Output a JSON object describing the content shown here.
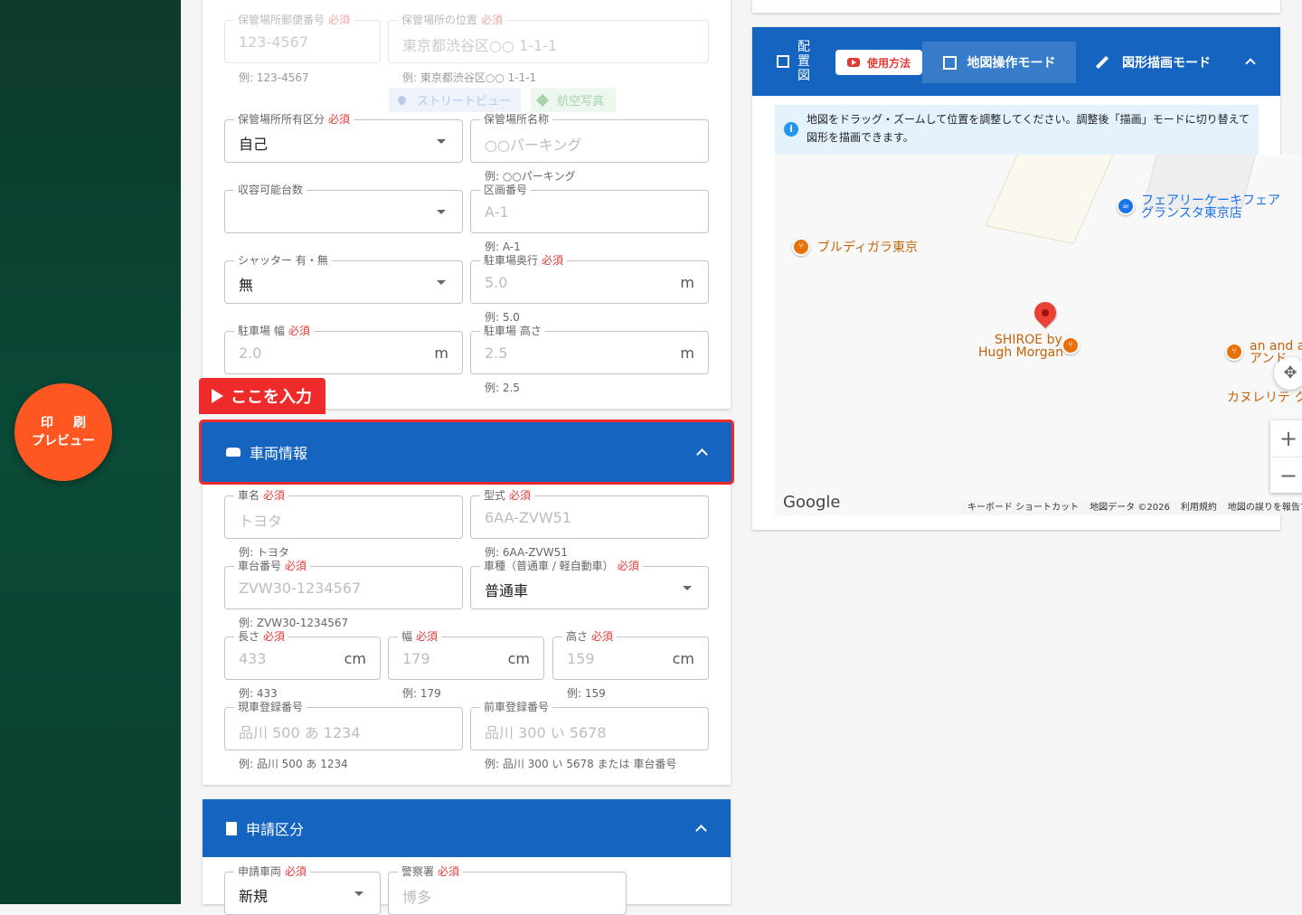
{
  "sidebar": {
    "print_line1": "印刷",
    "print_line2": "プレビュー"
  },
  "storage": {
    "postal": {
      "label": "保管場所郵便番号",
      "required": "必須",
      "placeholder": "123-4567",
      "help": "例: 123-4567"
    },
    "location": {
      "label": "保管場所の位置",
      "required": "必須",
      "placeholder": "東京都渋谷区○○ 1-1-1",
      "help": "例: 東京都渋谷区○○ 1-1-1"
    },
    "streetview": "ストリートビュー",
    "aerial": "航空写真",
    "ownership": {
      "label": "保管場所所有区分",
      "required": "必須",
      "value": "自己"
    },
    "name": {
      "label": "保管場所名称",
      "placeholder": "○○パーキング",
      "help": "例: ○○パーキング"
    },
    "capacity": {
      "label": "収容可能台数",
      "value": ""
    },
    "section_no": {
      "label": "区画番号",
      "placeholder": "A-1",
      "help": "例: A-1"
    },
    "shutter": {
      "label": "シャッター 有・無",
      "value": "無"
    },
    "depth": {
      "label": "駐車場奥行",
      "required": "必須",
      "placeholder": "5.0",
      "unit": "m",
      "help": "例: 5.0"
    },
    "width": {
      "label": "駐車場 幅",
      "required": "必須",
      "placeholder": "2.0",
      "unit": "m"
    },
    "height": {
      "label": "駐車場 高さ",
      "placeholder": "2.5",
      "unit": "m",
      "help": "例: 2.5"
    }
  },
  "callout": "ここを入力",
  "vehicle": {
    "title": "車両情報",
    "maker": {
      "label": "車名",
      "required": "必須",
      "placeholder": "トヨタ",
      "help": "例: トヨタ"
    },
    "model": {
      "label": "型式",
      "required": "必須",
      "placeholder": "6AA-ZVW51",
      "help": "例: 6AA-ZVW51"
    },
    "chassis": {
      "label": "車台番号",
      "required": "必須",
      "placeholder": "ZVW30-1234567",
      "help": "例: ZVW30-1234567"
    },
    "kind": {
      "label": "車種（普通車 / 軽自動車）",
      "required": "必須",
      "value": "普通車"
    },
    "length": {
      "label": "長さ",
      "required": "必須",
      "placeholder": "433",
      "unit": "cm",
      "help": "例: 433"
    },
    "width": {
      "label": "幅",
      "required": "必須",
      "placeholder": "179",
      "unit": "cm",
      "help": "例: 179"
    },
    "height": {
      "label": "高さ",
      "required": "必須",
      "placeholder": "159",
      "unit": "cm",
      "help": "例: 159"
    },
    "current_plate": {
      "label": "現車登録番号",
      "placeholder": "品川 500 あ 1234",
      "help": "例: 品川 500 あ 1234"
    },
    "previous_plate": {
      "label": "前車登録番号",
      "placeholder": "品川 300 い 5678",
      "help": "例: 品川 300 い 5678 または 車台番号"
    }
  },
  "application": {
    "title": "申請区分",
    "vehicle": {
      "label": "申請車両",
      "required": "必須",
      "value": "新規"
    },
    "police": {
      "label": "警察署",
      "required": "必須",
      "placeholder": "博多"
    }
  },
  "map_panel": {
    "title": "配置図",
    "howto": "使用方法",
    "mode_map": "地図操作モード",
    "mode_draw": "図形描画モード",
    "info": "地図をドラッグ・ズームして位置を調整してください。調整後「描画」モードに切り替えて図形を描画できます。",
    "info_icon": "i",
    "pois": [
      "ブルディガラ東京",
      "フェアリーケーキフェア",
      "グランスタ東京店",
      "SHIROE by",
      "Hugh Morgan",
      "an and an",
      "アンド",
      "カヌレリテ ク"
    ],
    "google": "Google",
    "footer": [
      "キーボード ショートカット",
      "地図データ ©2026",
      "利用規約",
      "地図の誤りを報告す"
    ],
    "zoom_in": "+",
    "zoom_out": "−",
    "colors": {
      "header": "#1565c0",
      "poi_orange": "#e8710a",
      "poi_blue": "#1a73e8",
      "pin_red": "#ea4335"
    }
  }
}
